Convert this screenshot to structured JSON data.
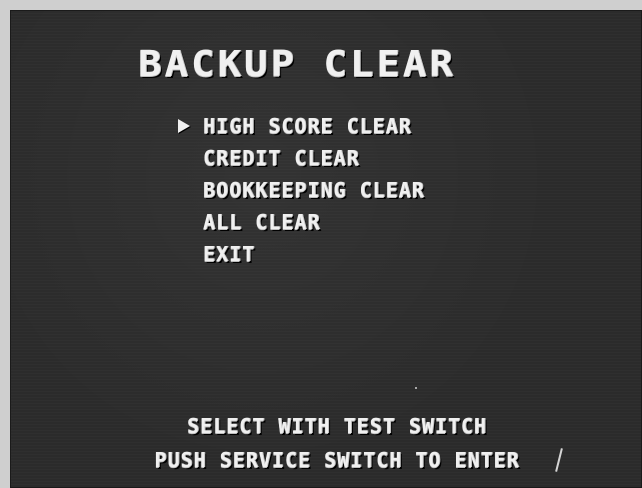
{
  "screen": {
    "title": "BACKUP CLEAR",
    "menu": {
      "cursor": "right-triangle-icon",
      "items": [
        {
          "label": "HIGH SCORE CLEAR"
        },
        {
          "label": "CREDIT CLEAR"
        },
        {
          "label": "BOOKKEEPING CLEAR"
        },
        {
          "label": "ALL CLEAR"
        },
        {
          "label": "EXIT"
        }
      ],
      "selected_index": 0
    },
    "instructions": {
      "line1": "SELECT WITH TEST SWITCH",
      "line2": "PUSH SERVICE SWITCH TO ENTER"
    }
  },
  "colors": {
    "background": "#2b2b2b",
    "text": "#f0f0f0",
    "bezel": "#cfcfcf"
  }
}
